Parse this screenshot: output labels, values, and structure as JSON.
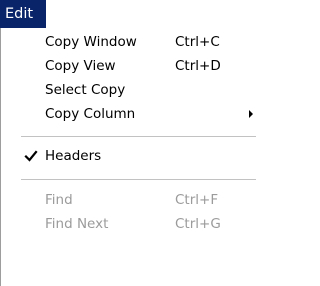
{
  "menu_bar": {
    "edit_label": "Edit"
  },
  "menu": {
    "copy_window": {
      "label": "Copy Window",
      "shortcut": "Ctrl+C"
    },
    "copy_view": {
      "label": "Copy View",
      "shortcut": "Ctrl+D"
    },
    "select_copy": {
      "label": "Select Copy"
    },
    "copy_column": {
      "label": "Copy Column",
      "submenu_icon": "submenu-arrow-icon"
    },
    "headers": {
      "label": "Headers",
      "checked": true,
      "icon": "check-icon"
    },
    "find": {
      "label": "Find",
      "shortcut": "Ctrl+F",
      "enabled": false
    },
    "find_next": {
      "label": "Find Next",
      "shortcut": "Ctrl+G",
      "enabled": false
    }
  },
  "colors": {
    "menu_bar_active_bg": "#0a246a",
    "menu_bar_active_text": "#ffffff",
    "disabled_text": "#9b9b9b",
    "separator": "#c2c2c2"
  }
}
